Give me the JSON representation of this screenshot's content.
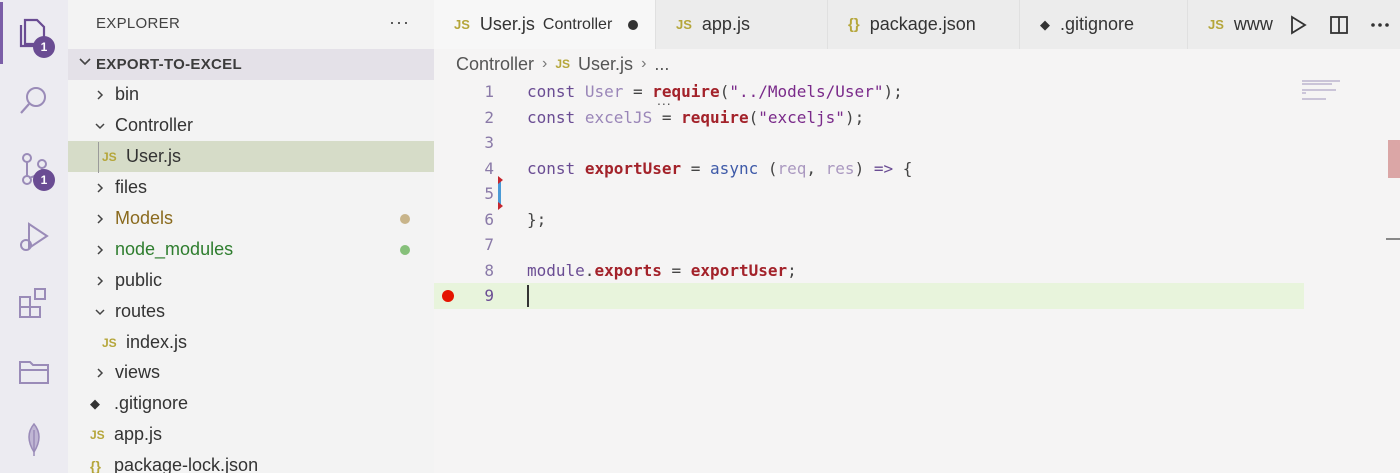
{
  "activity_bar": {
    "explorer_badge": "1",
    "scm_badge": "1"
  },
  "sidebar": {
    "title": "EXPLORER",
    "more": "···",
    "project": "EXPORT-TO-EXCEL",
    "items": [
      {
        "label": "bin",
        "chevron": "›",
        "type": "folder"
      },
      {
        "label": "Controller",
        "chevron": "⌄",
        "type": "folder"
      },
      {
        "label": "User.js",
        "icon": "JS",
        "type": "file"
      },
      {
        "label": "files",
        "chevron": "›",
        "type": "folder"
      },
      {
        "label": "Models",
        "chevron": "›",
        "type": "folder"
      },
      {
        "label": "node_modules",
        "chevron": "›",
        "type": "folder"
      },
      {
        "label": "public",
        "chevron": "›",
        "type": "folder"
      },
      {
        "label": "routes",
        "chevron": "⌄",
        "type": "folder"
      },
      {
        "label": "index.js",
        "icon": "JS",
        "type": "file"
      },
      {
        "label": "views",
        "chevron": "›",
        "type": "folder"
      },
      {
        "label": ".gitignore",
        "icon": "◆",
        "type": "file"
      },
      {
        "label": "app.js",
        "icon": "JS",
        "type": "file"
      },
      {
        "label": "package-lock.json",
        "icon": "{}",
        "type": "file"
      }
    ],
    "colors": {
      "models": "#8a6a1e",
      "node_modules": "#2e7d2e",
      "models_dot": "#c8b48a",
      "node_modules_dot": "#86c07a"
    }
  },
  "tabs": [
    {
      "icon": "JS",
      "label": "User.js",
      "desc": "Controller",
      "active": true,
      "modified": true
    },
    {
      "icon": "JS",
      "label": "app.js"
    },
    {
      "icon": "{}",
      "label": "package.json"
    },
    {
      "icon": "◆",
      "label": ".gitignore"
    },
    {
      "icon": "JS",
      "label": "www"
    }
  ],
  "breadcrumb": {
    "folder": "Controller",
    "file_icon": "JS",
    "file": "User.js",
    "tail": "..."
  },
  "editor": {
    "line_numbers": [
      "1",
      "2",
      "3",
      "4",
      "5",
      "6",
      "7",
      "8",
      "9"
    ],
    "hover_dots": "...",
    "code": {
      "l1_const": "const",
      "l1_var": "User",
      "l1_eq": " = ",
      "l1_fn": "require",
      "l1_open": "(",
      "l1_str": "\"../Models/User\"",
      "l1_close": ");",
      "l2_const": "const",
      "l2_var": "excelJS",
      "l2_eq": " = ",
      "l2_fn": "require",
      "l2_open": "(",
      "l2_str": "\"exceljs\"",
      "l2_close": ");",
      "l4_const": "const",
      "l4_fn": "exportUser",
      "l4_eq": " = ",
      "l4_async": "async",
      "l4_open": " (",
      "l4_p1": "req",
      "l4_comma": ", ",
      "l4_p2": "res",
      "l4_close": ") ",
      "l4_arrow": "=>",
      "l4_brace": " {",
      "l6": "};",
      "l8_module": "module",
      "l8_dot": ".",
      "l8_exports": "exports",
      "l8_eq": " = ",
      "l8_fn": "exportUser",
      "l8_end": ";"
    }
  }
}
